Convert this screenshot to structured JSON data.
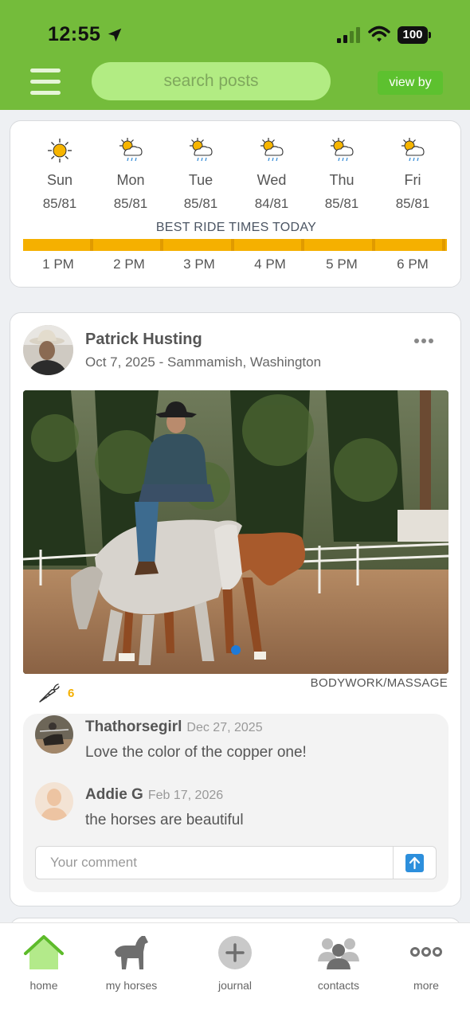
{
  "status_bar": {
    "time": "12:55",
    "battery": "100"
  },
  "header": {
    "search_placeholder": "search posts",
    "view_by_label": "view by"
  },
  "weather": {
    "days": [
      {
        "name": "Sun",
        "temp": "85/81",
        "icon": "sun-icon"
      },
      {
        "name": "Mon",
        "temp": "85/81",
        "icon": "rain-sun-icon"
      },
      {
        "name": "Tue",
        "temp": "85/81",
        "icon": "rain-sun-icon"
      },
      {
        "name": "Wed",
        "temp": "84/81",
        "icon": "rain-sun-icon"
      },
      {
        "name": "Thu",
        "temp": "85/81",
        "icon": "rain-sun-icon"
      },
      {
        "name": "Fri",
        "temp": "85/81",
        "icon": "rain-sun-icon"
      }
    ],
    "best_ride_label": "BEST RIDE TIMES TODAY",
    "hours": [
      "1 PM",
      "2 PM",
      "3 PM",
      "4 PM",
      "5 PM",
      "6 PM"
    ]
  },
  "post": {
    "author": "Patrick Husting",
    "meta": "Oct 7, 2025 - Sammamish, Washington",
    "category": "BODYWORK/MASSAGE",
    "likes": "6",
    "comments": [
      {
        "name": "Thathorsegirl",
        "date": "Dec 27, 2025",
        "text": "Love the color of the copper one!"
      },
      {
        "name": "Addie G",
        "date": "Feb 17, 2026",
        "text": "the horses are beautiful"
      }
    ],
    "comment_placeholder": "Your comment"
  },
  "tabbar": {
    "items": [
      {
        "label": "home",
        "icon": "home-icon",
        "active": true
      },
      {
        "label": "my horses",
        "icon": "horse-icon",
        "active": false
      },
      {
        "label": "journal",
        "icon": "plus-circle-icon",
        "active": false
      },
      {
        "label": "contacts",
        "icon": "people-icon",
        "active": false
      },
      {
        "label": "more",
        "icon": "more-dots-icon",
        "active": false
      }
    ]
  },
  "colors": {
    "brand_green": "#74bc3b",
    "accent_yellow": "#f5b000",
    "send_blue": "#2d8fdc"
  }
}
